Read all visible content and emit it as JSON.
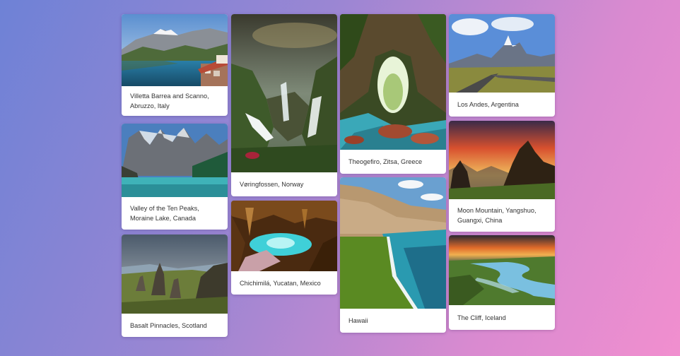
{
  "gallery": {
    "cards": [
      {
        "id": "villetta-barrea",
        "caption": "Villetta Barrea and Scanno, Abruzzo, Italy",
        "image": "lake-town-mountains-photo"
      },
      {
        "id": "valley-ten-peaks",
        "caption": "Valley of the Ten Peaks, Moraine Lake, Canada",
        "image": "mountain-lake-photo"
      },
      {
        "id": "basalt-pinnacles",
        "caption": "Basalt Pinnacles, Scotland",
        "image": "rock-pinnacles-photo"
      },
      {
        "id": "voringfossen",
        "caption": "Vøringfossen, Norway",
        "image": "waterfall-canyon-photo"
      },
      {
        "id": "chichimila",
        "caption": "Chichimilá, Yucatan, Mexico",
        "image": "cave-cenote-photo"
      },
      {
        "id": "theogefiro",
        "caption": "Theogefiro, Zitsa, Greece",
        "image": "stone-arch-river-photo"
      },
      {
        "id": "hawaii",
        "caption": "Hawaii",
        "image": "green-sand-beach-photo"
      },
      {
        "id": "los-andes",
        "caption": "Los Andes, Argentina",
        "image": "andes-road-photo"
      },
      {
        "id": "moon-mountain",
        "caption": "Moon Mountain, Yangshuo, Guangxi, China",
        "image": "sunset-peaks-photo"
      },
      {
        "id": "the-cliff",
        "caption": "The Cliff, Iceland",
        "image": "river-sunset-photo"
      }
    ]
  }
}
